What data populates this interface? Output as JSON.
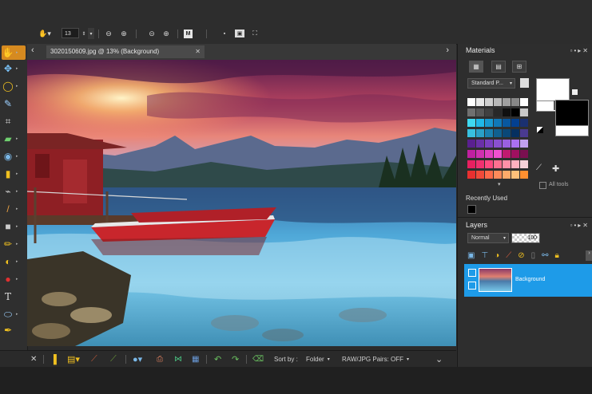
{
  "toolbar": {
    "zoom_value": "13",
    "m_label": "M"
  },
  "tab": {
    "title": "3020150609.jpg @  13% (Background)"
  },
  "bottombar": {
    "sortby_label": "Sort by :",
    "sortby_value": "Folder",
    "rawjpg_label": "RAW/JPG Pairs: OFF"
  },
  "materials": {
    "title": "Materials",
    "palette_dropdown": "Standard P...",
    "all_tools_label": "All tools",
    "recently_used_label": "Recently Used"
  },
  "layers": {
    "title": "Layers",
    "blend_mode": "Normal",
    "opacity": "100",
    "layer_name": "Background"
  },
  "colors": {
    "accent": "#1e9be8",
    "tab_bg": "#4a4a4a",
    "panel_bg": "#2e2e2e"
  },
  "icons": [
    "pan-icon",
    "zoom-out-icon",
    "zoom-in-icon",
    "move-icon",
    "lasso-icon",
    "crop-icon",
    "text-tool-icon",
    "layer-visibility-icon",
    "lock-icon"
  ]
}
